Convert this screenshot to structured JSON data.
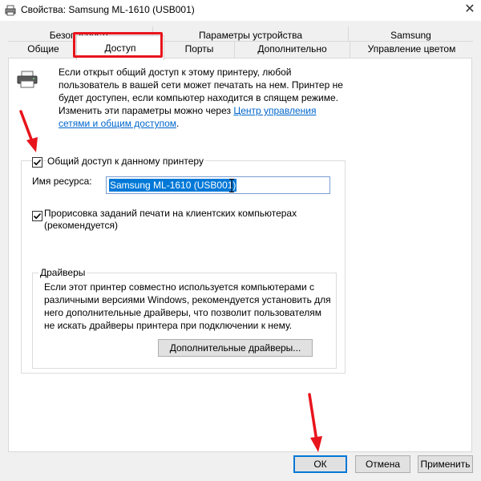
{
  "window": {
    "title": "Свойства: Samsung ML-1610 (USB001)",
    "close_glyph": "✕"
  },
  "tabs": {
    "row1": [
      "Безопасность",
      "Параметры устройства",
      "Samsung"
    ],
    "row2": [
      "Общие",
      "Доступ",
      "Порты",
      "Дополнительно",
      "Управление цветом"
    ],
    "active": "Доступ"
  },
  "sharing": {
    "info_text": "Если открыт общий доступ к этому принтеру, любой пользователь в вашей сети может печатать на нем. Принтер не будет доступен, если компьютер находится в спящем режиме. Изменить эти параметры можно через ",
    "info_link": "Центр управления сетями и общим доступом",
    "info_end": ".",
    "share_checkbox_label": "Общий доступ к данному принтеру",
    "share_checked": true,
    "resource_label": "Имя ресурса:",
    "resource_value": "Samsung ML-1610 (USB001)",
    "render_checkbox_label": "Прорисовка заданий печати на клиентских компьютерах (рекомендуется)",
    "render_checked": true
  },
  "drivers": {
    "title": "Драйверы",
    "text": "Если этот принтер совместно используется компьютерами с различными версиями Windows, рекомендуется установить для него дополнительные драйверы, что позволит пользователям не искать драйверы принтера при подключении к нему.",
    "button": "Дополнительные драйверы..."
  },
  "footer": {
    "ok": "ОК",
    "cancel": "Отмена",
    "apply": "Применить"
  },
  "colors": {
    "annotation_red": "#e8141c",
    "link_blue": "#0066cc",
    "selection_blue": "#0078d7"
  },
  "icons": [
    "printer-icon",
    "close-icon",
    "checkmark-icon",
    "text-cursor-icon",
    "red-arrow-icon"
  ]
}
